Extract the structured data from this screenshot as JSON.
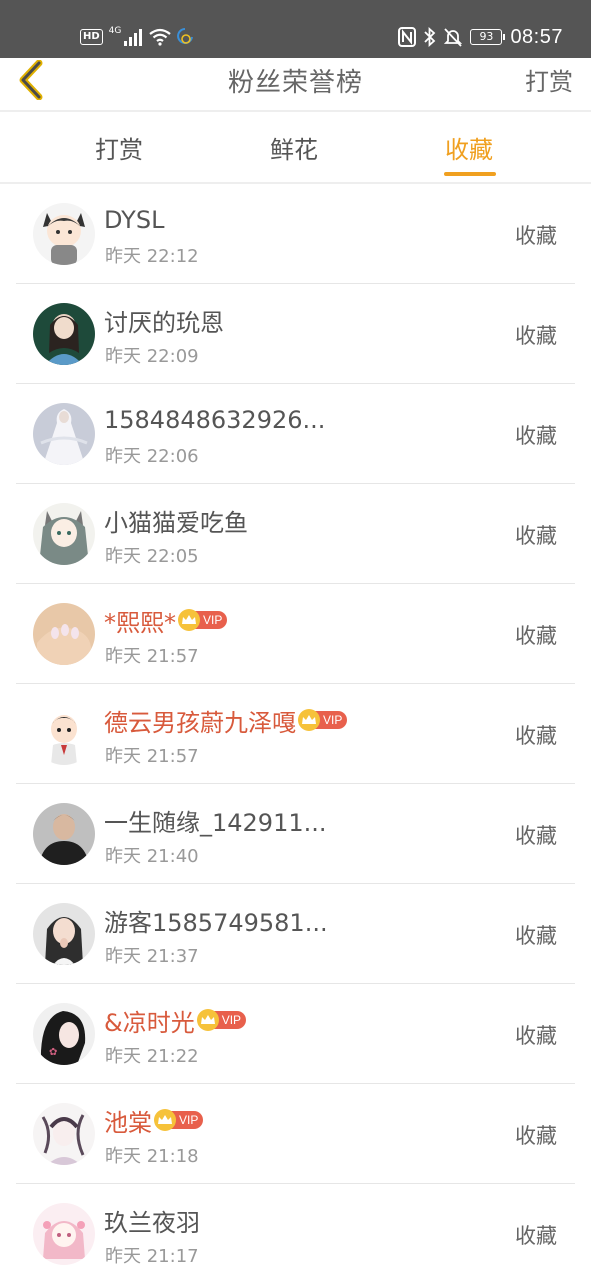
{
  "status_bar": {
    "hd": "HD",
    "network": "4G",
    "battery": "93",
    "time": "08:57"
  },
  "header": {
    "title": "粉丝荣誉榜",
    "action": "打赏"
  },
  "tabs": [
    {
      "label": "打赏",
      "active": false
    },
    {
      "label": "鲜花",
      "active": false
    },
    {
      "label": "收藏",
      "active": true
    }
  ],
  "colors": {
    "accent": "#f0a020",
    "vip_name": "#d85a3c",
    "vip_tag": "#e8604c",
    "crown": "#f6c23a"
  },
  "list": [
    {
      "name": "DYSL",
      "time": "昨天 22:12",
      "action": "收藏",
      "vip": false,
      "avatar": "avatar-cartoon-cat-boy"
    },
    {
      "name": "讨厌的玧恩",
      "time": "昨天 22:09",
      "action": "收藏",
      "vip": false,
      "avatar": "avatar-doll-photo"
    },
    {
      "name": "1584848632926...",
      "time": "昨天 22:06",
      "action": "收藏",
      "vip": false,
      "avatar": "avatar-white-gown"
    },
    {
      "name": "小猫猫爱吃鱼",
      "time": "昨天 22:05",
      "action": "收藏",
      "vip": false,
      "avatar": "avatar-anime-girl"
    },
    {
      "name": "*熙熙*",
      "time": "昨天 21:57",
      "action": "收藏",
      "vip": true,
      "vip_label": "VIP",
      "avatar": "avatar-hand-nails"
    },
    {
      "name": "德云男孩蔚九泽嘎",
      "time": "昨天 21:57",
      "action": "收藏",
      "vip": true,
      "vip_label": "VIP",
      "avatar": "avatar-cartoon-boy"
    },
    {
      "name": "一生随缘_142911...",
      "time": "昨天 21:40",
      "action": "收藏",
      "vip": false,
      "avatar": "avatar-man-dark"
    },
    {
      "name": "游客1585749581...",
      "time": "昨天 21:37",
      "action": "收藏",
      "vip": false,
      "avatar": "avatar-woman-portrait"
    },
    {
      "name": "&凉时光",
      "time": "昨天 21:22",
      "action": "收藏",
      "vip": true,
      "vip_label": "VIP",
      "avatar": "avatar-dark-hair-girl"
    },
    {
      "name": "池棠",
      "time": "昨天 21:18",
      "action": "收藏",
      "vip": true,
      "vip_label": "VIP",
      "avatar": "avatar-sketch-girl"
    },
    {
      "name": "玖兰夜羽",
      "time": "昨天 21:17",
      "action": "收藏",
      "vip": false,
      "avatar": "avatar-pink-anime"
    }
  ]
}
